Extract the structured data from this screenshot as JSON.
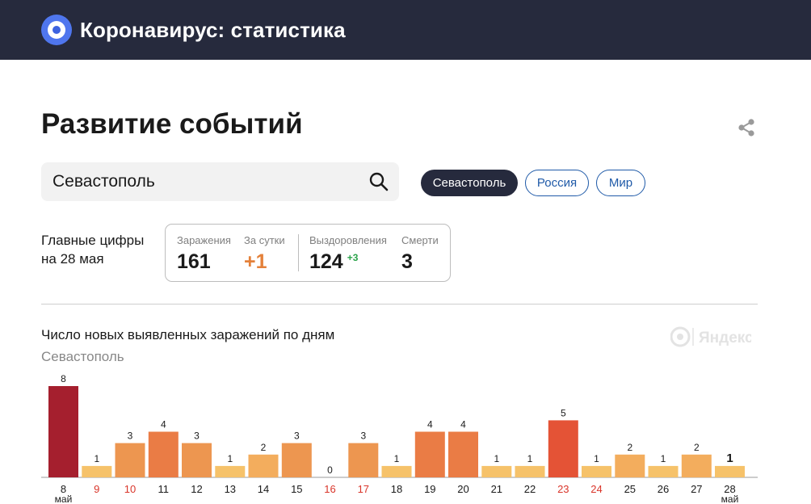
{
  "header": {
    "title": "Коронавирус: статистика",
    "logo_icon": "yandex-target-icon",
    "background": "#262a3d"
  },
  "page": {
    "title": "Развитие событий",
    "share_icon": "share-icon"
  },
  "search": {
    "value": "Севастополь",
    "icon": "search-icon"
  },
  "region_tabs": [
    {
      "label": "Севастополь",
      "active": true
    },
    {
      "label": "Россия",
      "active": false
    },
    {
      "label": "Мир",
      "active": false
    }
  ],
  "main_figures": {
    "label_line1": "Главные цифры",
    "label_line2": "на 28 мая",
    "infections": {
      "label": "Заражения",
      "value": "161"
    },
    "per_day": {
      "label": "За сутки",
      "value": "+1"
    },
    "recovered": {
      "label": "Выздоровления",
      "value": "124",
      "delta": "+3"
    },
    "deaths": {
      "label": "Смерти",
      "value": "3"
    }
  },
  "chart_section": {
    "title": "Число новых выявленных заражений по дням",
    "subtitle": "Севастополь",
    "watermark": "Яндекс"
  },
  "chart_data": {
    "type": "bar",
    "title": "Число новых выявленных заражений по дням",
    "subtitle": "Севастополь",
    "categories": [
      "8",
      "9",
      "10",
      "11",
      "12",
      "13",
      "14",
      "15",
      "16",
      "17",
      "18",
      "19",
      "20",
      "21",
      "22",
      "23",
      "24",
      "25",
      "26",
      "27",
      "28"
    ],
    "month_labels": {
      "0": "май",
      "20": "май"
    },
    "weekend_categories": [
      "9",
      "10",
      "16",
      "17",
      "23",
      "24"
    ],
    "values": [
      8,
      1,
      3,
      4,
      3,
      1,
      2,
      3,
      0,
      3,
      1,
      4,
      4,
      1,
      1,
      5,
      1,
      2,
      1,
      2,
      1
    ],
    "ylim": [
      0,
      8
    ],
    "grid": false,
    "colors": {
      "1": "#f6c26a",
      "2": "#f3ad5d",
      "3": "#ed9650",
      "4": "#ea7c45",
      "5": "#e45336",
      "8": "#a51f2e"
    },
    "weekend_color": "#d9352a",
    "weekday_color": "#1a1a1a"
  }
}
